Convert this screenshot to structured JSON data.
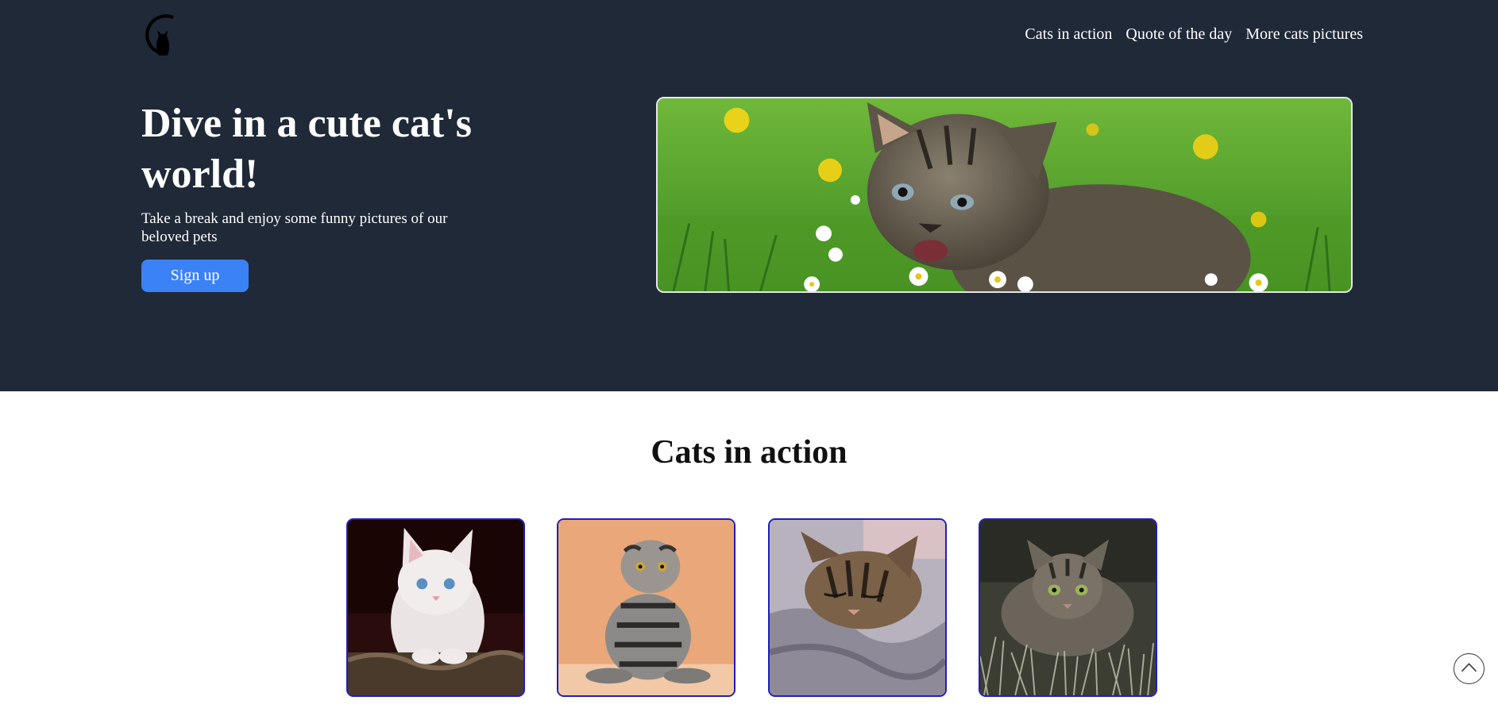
{
  "header": {
    "logo_icon": "cat-logo-icon",
    "nav": [
      {
        "label": "Cats in action"
      },
      {
        "label": "Quote of the day"
      },
      {
        "label": "More cats pictures"
      }
    ]
  },
  "hero": {
    "title": "Dive in a cute cat's world!",
    "subtitle": "Take a break and enjoy some funny pictures of our beloved pets",
    "signup_label": "Sign up",
    "image_alt": "Tabby kitten in a meadow with daisies and dandelions"
  },
  "cats_section": {
    "title": "Cats in action",
    "cards": [
      {
        "alt": "White kitten with blue eyes"
      },
      {
        "alt": "Scottish fold tabby cat sitting"
      },
      {
        "alt": "Sleeping tabby cat on a blanket"
      },
      {
        "alt": "Tabby cat crouching in grass"
      }
    ]
  },
  "colors": {
    "hero_background": "#1f2937",
    "accent": "#3b82f6",
    "card_border": "#1e1ebe"
  },
  "icons": {
    "scroll_top": "chevron-up-icon"
  }
}
